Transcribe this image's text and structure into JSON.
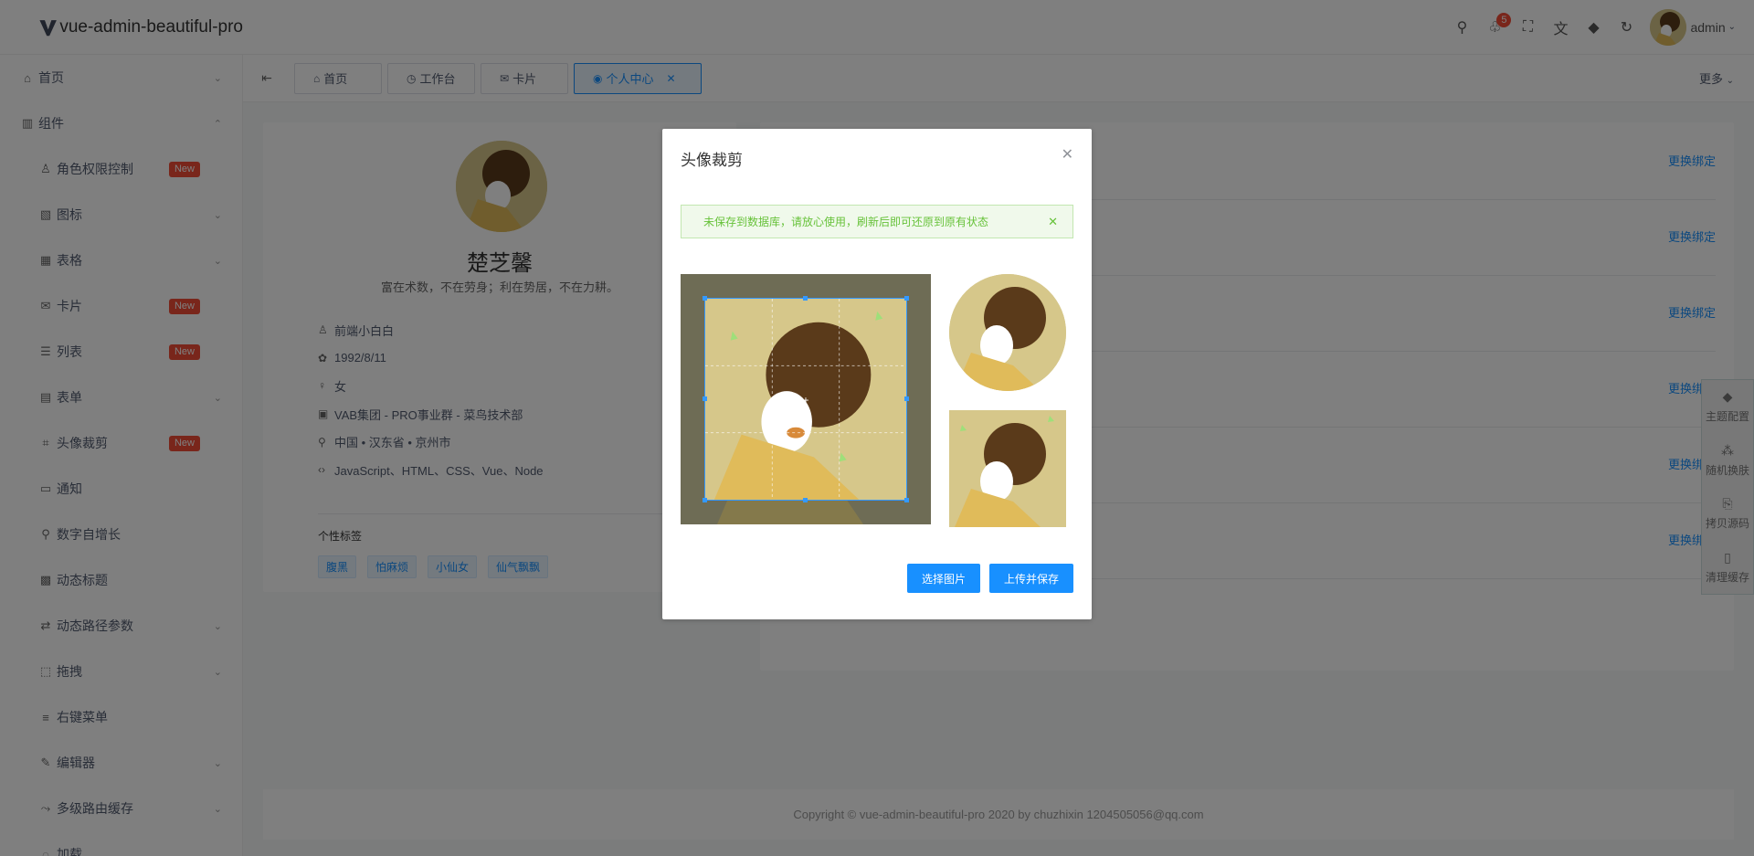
{
  "header": {
    "logo_text": "vue-admin-beautiful-pro",
    "notification_count": "5",
    "username": "admin",
    "icons": [
      "search-icon",
      "bell-icon",
      "fullscreen-icon",
      "translate-icon",
      "theme-icon",
      "refresh-icon"
    ]
  },
  "sidebar": {
    "items": [
      {
        "label": "首页",
        "icon": "home-icon",
        "chevron": "down",
        "sub": false,
        "badge": ""
      },
      {
        "label": "组件",
        "icon": "chart-icon",
        "chevron": "up",
        "sub": false,
        "badge": ""
      },
      {
        "label": "角色权限控制",
        "icon": "user-icon",
        "chevron": "",
        "sub": true,
        "badge": "New"
      },
      {
        "label": "图标",
        "icon": "image-icon",
        "chevron": "down",
        "sub": true,
        "badge": ""
      },
      {
        "label": "表格",
        "icon": "table-icon",
        "chevron": "down",
        "sub": true,
        "badge": ""
      },
      {
        "label": "卡片",
        "icon": "inbox-icon",
        "chevron": "",
        "sub": true,
        "badge": "New"
      },
      {
        "label": "列表",
        "icon": "list-icon",
        "chevron": "",
        "sub": true,
        "badge": "New"
      },
      {
        "label": "表单",
        "icon": "form-icon",
        "chevron": "down",
        "sub": true,
        "badge": ""
      },
      {
        "label": "头像裁剪",
        "icon": "crop-icon",
        "chevron": "",
        "sub": true,
        "badge": "New"
      },
      {
        "label": "通知",
        "icon": "message-icon",
        "chevron": "",
        "sub": true,
        "badge": ""
      },
      {
        "label": "数字自增长",
        "icon": "pin-icon",
        "chevron": "",
        "sub": true,
        "badge": ""
      },
      {
        "label": "动态标题",
        "icon": "grid-icon",
        "chevron": "",
        "sub": true,
        "badge": ""
      },
      {
        "label": "动态路径参数",
        "icon": "swap-icon",
        "chevron": "down",
        "sub": true,
        "badge": ""
      },
      {
        "label": "拖拽",
        "icon": "drag-icon",
        "chevron": "down",
        "sub": true,
        "badge": ""
      },
      {
        "label": "右键菜单",
        "icon": "menu-icon",
        "chevron": "",
        "sub": true,
        "badge": ""
      },
      {
        "label": "编辑器",
        "icon": "edit-icon",
        "chevron": "down",
        "sub": true,
        "badge": ""
      },
      {
        "label": "多级路由缓存",
        "icon": "route-icon",
        "chevron": "down",
        "sub": true,
        "badge": ""
      },
      {
        "label": "加载",
        "icon": "loading-icon",
        "chevron": "",
        "sub": true,
        "badge": ""
      }
    ]
  },
  "tabs": [
    {
      "label": "首页",
      "icon": "home-icon",
      "active": false
    },
    {
      "label": "工作台",
      "icon": "clock-icon",
      "active": false
    },
    {
      "label": "卡片",
      "icon": "inbox-icon",
      "active": false
    },
    {
      "label": "个人中心",
      "icon": "user-circle-icon",
      "active": true
    }
  ],
  "tabs_more": "更多",
  "profile": {
    "name": "楚芝馨",
    "motto": "富在术数，不在劳身；利在势居，不在力耕。",
    "info": [
      {
        "icon": "user-icon",
        "text": "前端小白白"
      },
      {
        "icon": "cake-icon",
        "text": "1992/8/11"
      },
      {
        "icon": "female-icon",
        "text": "女"
      },
      {
        "icon": "building-icon",
        "text": "VAB集团 - PRO事业群 - 菜鸟技术部"
      },
      {
        "icon": "location-icon",
        "text": "中国 • 汉东省 • 京州市"
      },
      {
        "icon": "code-icon",
        "text": "JavaScript、HTML、CSS、Vue、Node"
      }
    ],
    "tags_title": "个性标签",
    "tags": [
      "腹黑",
      "怕麻烦",
      "小仙女",
      "仙气飘飘"
    ]
  },
  "bindings": {
    "link_label": "更换绑定",
    "count": 6
  },
  "theme_panel": [
    {
      "icon": "theme-icon",
      "label": "主题配置"
    },
    {
      "icon": "random-icon",
      "label": "随机换肤"
    },
    {
      "icon": "copy-icon",
      "label": "拷贝源码"
    },
    {
      "icon": "trash-icon",
      "label": "清理缓存"
    }
  ],
  "footer": {
    "text": "Copyright  ©  vue-admin-beautiful-pro 2020 by chuzhixin 1204505056@qq.com"
  },
  "dialog": {
    "title": "头像裁剪",
    "alert": "未保存到数据库，请放心使用，刷新后即可还原到原有状态",
    "btn_select": "选择图片",
    "btn_upload": "上传并保存"
  },
  "colors": {
    "accent": "#1890ff",
    "danger": "#f34d37",
    "success": "#67c23a"
  }
}
